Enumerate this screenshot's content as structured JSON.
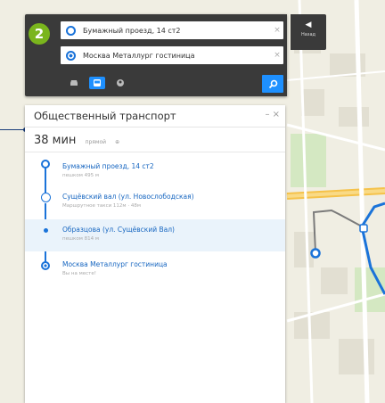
{
  "search": {
    "from": "Бумажный проезд, 14 ст2",
    "to": "Москва Металлург гостиница",
    "clear_glyph": "×",
    "swap_glyph": "⇅"
  },
  "modes": [
    {
      "icon": "car-icon",
      "active": false
    },
    {
      "icon": "bus-icon",
      "active": true
    },
    {
      "icon": "walk-icon",
      "active": false
    }
  ],
  "back_button": {
    "label": "Назад"
  },
  "route_panel": {
    "title": "Общественный транспорт",
    "controls": "– ×",
    "duration": "38 мин",
    "direct_label": "прямой",
    "stops": [
      {
        "name": "Бумажный проезд, 14 ст2",
        "sub": "пешком 495 м"
      },
      {
        "name": "Сущёвский вал (ул. Новослободская)",
        "sub": "Маршрутное такси 112м · 48м"
      },
      {
        "name": "Образцова (ул. Сущёвский Вал)",
        "sub": "пешком 814 м"
      },
      {
        "name": "Москва Металлург гостиница",
        "sub": "Вы на месте!"
      }
    ]
  },
  "colors": {
    "accent": "#1e90ff",
    "route": "#1a73d9",
    "panel": "#3a3a3a",
    "logo": "#7ab51d"
  }
}
